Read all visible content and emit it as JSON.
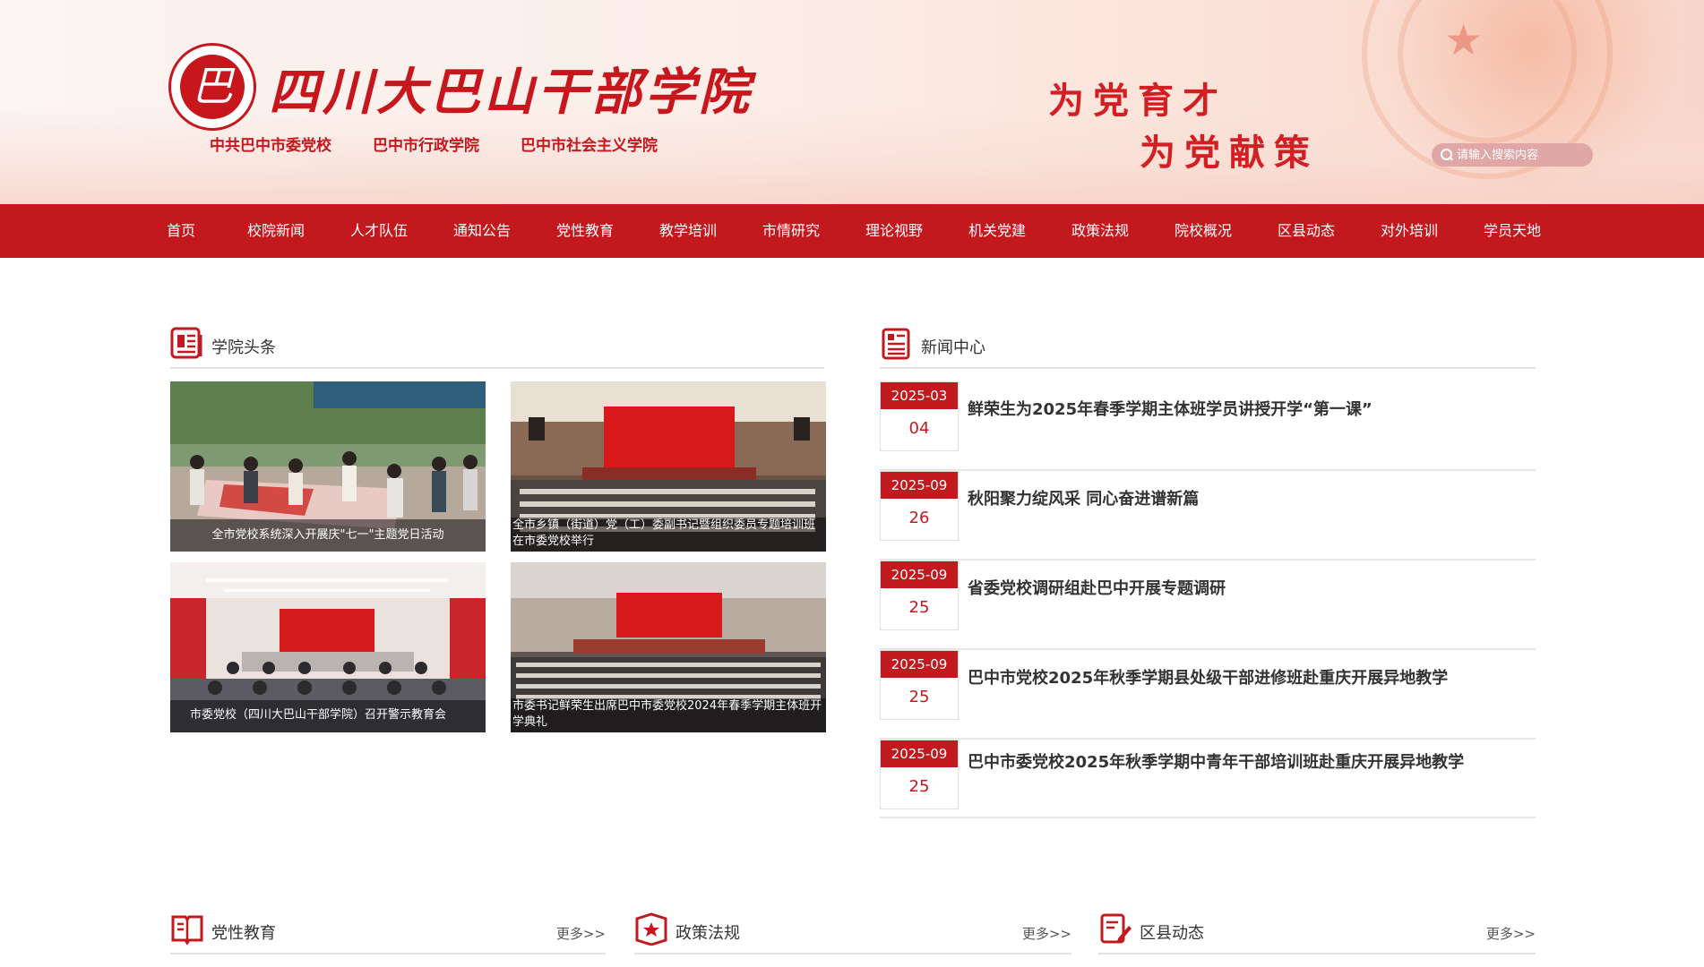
{
  "header": {
    "logo_text": "巴",
    "site_title": "四川大巴山干部学院",
    "sub_links": [
      "中共巴中市委党校",
      "巴中市行政学院",
      "巴中市社会主义学院"
    ],
    "slogan_line1": "为党育才",
    "slogan_line2": "为党献策",
    "search_placeholder": "请输入搜索内容"
  },
  "nav": {
    "items": [
      "首页",
      "校院新闻",
      "人才队伍",
      "通知公告",
      "党性教育",
      "教学培训",
      "市情研究",
      "理论视野",
      "机关党建",
      "政策法规",
      "院校概况",
      "区县动态",
      "对外培训",
      "学员天地"
    ]
  },
  "headlines": {
    "title": "学院头条",
    "photos": [
      {
        "caption": "全市党校系统深入开展庆\"七一\"主题党日活动"
      },
      {
        "caption": "全市乡镇（街道）党（工）委副书记暨组织委员专题培训班在市委党校举行"
      },
      {
        "caption": "市委党校（四川大巴山干部学院）召开警示教育会"
      },
      {
        "caption": "市委书记鲜荣生出席巴中市委党校2024年春季学期主体班开学典礼"
      }
    ]
  },
  "news_center": {
    "title": "新闻中心",
    "items": [
      {
        "ym": "2025-03",
        "day": "04",
        "title": "鲜荣生为2025年春季学期主体班学员讲授开学“第一课”"
      },
      {
        "ym": "2025-09",
        "day": "26",
        "title": "秋阳聚力绽风采 同心奋进谱新篇"
      },
      {
        "ym": "2025-09",
        "day": "25",
        "title": "省委党校调研组赴巴中开展专题调研"
      },
      {
        "ym": "2025-09",
        "day": "25",
        "title": "巴中市党校2025年秋季学期县处级干部进修班赴重庆开展异地教学"
      },
      {
        "ym": "2025-09",
        "day": "25",
        "title": "巴中市委党校2025年秋季学期中青年干部培训班赴重庆开展异地教学"
      }
    ]
  },
  "bottom_sections": [
    {
      "title": "党性教育",
      "more": "更多>>"
    },
    {
      "title": "政策法规",
      "more": "更多>>"
    },
    {
      "title": "区县动态",
      "more": "更多>>"
    }
  ],
  "colors": {
    "brand_red": "#c2191f",
    "title_red": "#c8161d"
  }
}
